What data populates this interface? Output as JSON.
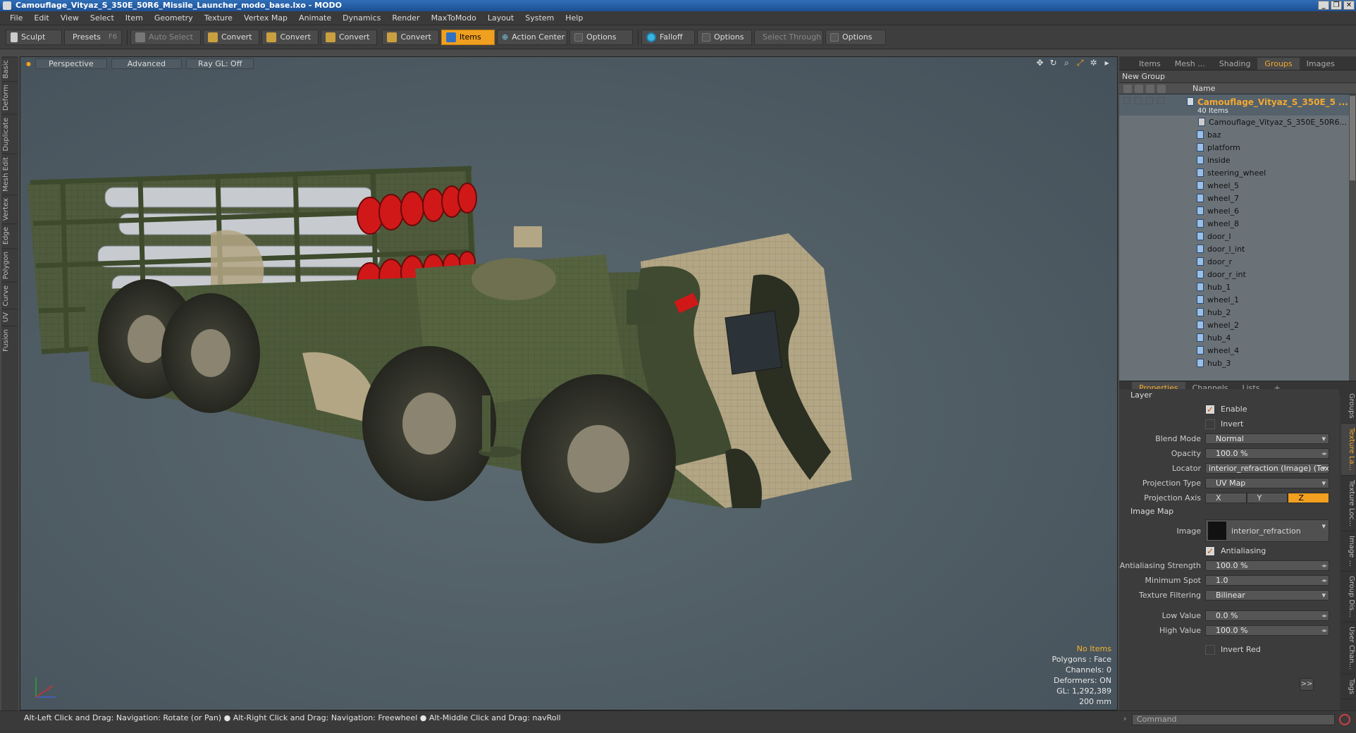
{
  "window": {
    "title": "Camouflage_Vityaz_S_350E_50R6_Missile_Launcher_modo_base.lxo - MODO"
  },
  "menu": [
    "File",
    "Edit",
    "View",
    "Select",
    "Item",
    "Geometry",
    "Texture",
    "Vertex Map",
    "Animate",
    "Dynamics",
    "Render",
    "MaxToModo",
    "Layout",
    "System",
    "Help"
  ],
  "toolbar": {
    "sculpt": "Sculpt",
    "presets": "Presets",
    "presets_key": "F6",
    "auto_select": "Auto Select",
    "convert1": "Convert",
    "convert2": "Convert",
    "convert3": "Convert",
    "convert4": "Convert",
    "items": "Items",
    "action_center": "Action Center",
    "options1": "Options",
    "falloff": "Falloff",
    "options2": "Options",
    "select_through": "Select Through",
    "options3": "Options"
  },
  "left_tabs": [
    "Basic",
    "Deform",
    "Duplicate",
    "Mesh Edit",
    "Vertex",
    "Edge",
    "Polygon",
    "Curve",
    "UV",
    "Fusion"
  ],
  "viewport": {
    "view": "Perspective",
    "shading": "Advanced",
    "raygl": "Ray GL: Off",
    "stats": {
      "selection": "No Items",
      "polygons": "Polygons : Face",
      "channels": "Channels: 0",
      "deformers": "Deformers: ON",
      "gl": "GL: 1,292,389",
      "size": "200 mm"
    }
  },
  "items_panel": {
    "tabs": [
      "Items",
      "Mesh ...",
      "Shading",
      "Groups",
      "Images"
    ],
    "active_tab": "Groups",
    "new_group": "New Group",
    "col_name": "Name",
    "group_name": "Camouflage_Vityaz_S_350E_5 ...",
    "group_count": "40 Items",
    "items": [
      "Camouflage_Vityaz_S_350E_50R6...",
      "baz",
      "platform",
      "inside",
      "steering_wheel",
      "wheel_5",
      "wheel_7",
      "wheel_6",
      "wheel_8",
      "door_l",
      "door_l_int",
      "door_r",
      "door_r_int",
      "hub_1",
      "wheel_1",
      "hub_2",
      "wheel_2",
      "hub_4",
      "wheel_4",
      "hub_3"
    ]
  },
  "props_panel": {
    "tabs": [
      "Properties",
      "Channels",
      "Lists"
    ],
    "section_layer": "Layer",
    "enable": "Enable",
    "invert": "Invert",
    "blend_mode_label": "Blend Mode",
    "blend_mode": "Normal",
    "opacity_label": "Opacity",
    "opacity": "100.0 %",
    "locator_label": "Locator",
    "locator": "interior_refraction (Image) (Text ...",
    "projection_type_label": "Projection Type",
    "projection_type": "UV Map",
    "projection_axis_label": "Projection Axis",
    "axis_x": "X",
    "axis_y": "Y",
    "axis_z": "Z",
    "section_image": "Image Map",
    "image_label": "Image",
    "image": "interior_refraction",
    "antialiasing": "Antialiasing",
    "aa_strength_label": "Antialiasing Strength",
    "aa_strength": "100.0 %",
    "min_spot_label": "Minimum Spot",
    "min_spot": "1.0",
    "tex_filter_label": "Texture Filtering",
    "tex_filter": "Bilinear",
    "low_label": "Low Value",
    "low": "0.0 %",
    "high_label": "High Value",
    "high": "100.0 %",
    "invert_red": "Invert Red",
    "expand": ">>"
  },
  "side_tabs": [
    "Groups",
    "Texture La...",
    "Texture Loc...",
    "Image ...",
    "Group Dis...",
    "User Chan...",
    "Tags"
  ],
  "status": {
    "hint": "Alt-Left Click and Drag: Navigation: Rotate (or Pan) ● Alt-Right Click and Drag: Navigation: Freewheel ● Alt-Middle Click and Drag: navRoll"
  },
  "command": {
    "placeholder": "Command"
  },
  "colors": {
    "accent": "#f2a020",
    "camo_green": "#4d5a3a",
    "camo_tan": "#b3a684",
    "missile_red": "#d01818"
  }
}
